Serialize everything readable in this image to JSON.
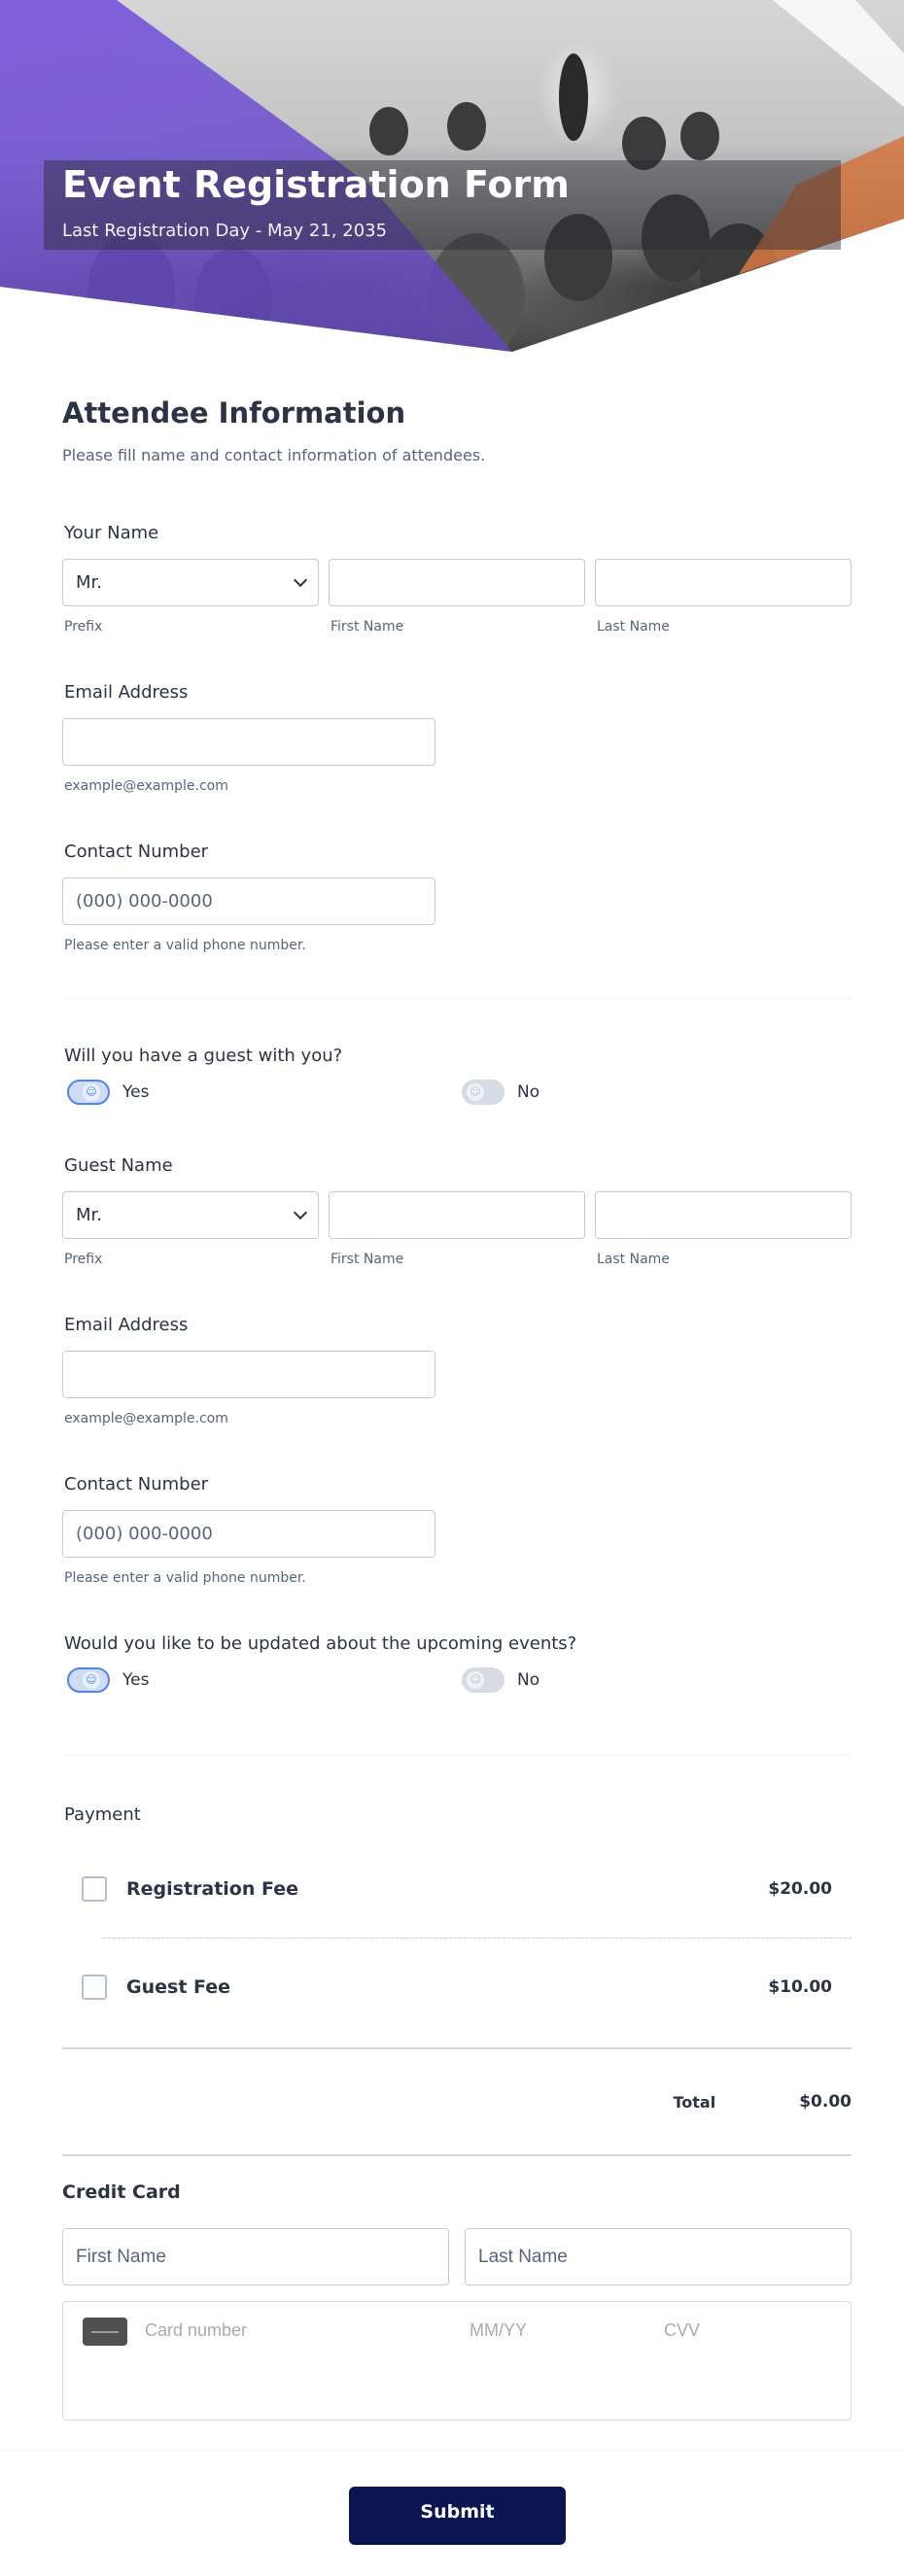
{
  "header": {
    "title": "Event Registration Form",
    "subtitle": "Last Registration Day - May 21, 2035"
  },
  "attendee": {
    "heading": "Attendee Information",
    "description": "Please fill name and contact information of attendees.",
    "name_label": "Your Name",
    "prefix_value": "Mr.",
    "prefix_sublabel": "Prefix",
    "first_sublabel": "First Name",
    "last_sublabel": "Last Name",
    "email_label": "Email Address",
    "email_sublabel": "example@example.com",
    "phone_label": "Contact Number",
    "phone_placeholder": "(000) 000-0000",
    "phone_sublabel": "Please enter a valid phone number."
  },
  "guest_question": {
    "label": "Will you have a guest with you?",
    "yes": "Yes",
    "no": "No",
    "selected": "Yes"
  },
  "guest": {
    "name_label": "Guest Name",
    "prefix_value": "Mr.",
    "prefix_sublabel": "Prefix",
    "first_sublabel": "First Name",
    "last_sublabel": "Last Name",
    "email_label": "Email Address",
    "email_sublabel": "example@example.com",
    "phone_label": "Contact Number",
    "phone_placeholder": "(000) 000-0000",
    "phone_sublabel": "Please enter a valid phone number."
  },
  "updates_question": {
    "label": "Would you like to be updated about the upcoming events?",
    "yes": "Yes",
    "no": "No",
    "selected": "Yes"
  },
  "payment": {
    "label": "Payment",
    "items": [
      {
        "name": "Registration Fee",
        "price": "$20.00",
        "checked": false
      },
      {
        "name": "Guest Fee",
        "price": "$10.00",
        "checked": false
      }
    ],
    "total_label": "Total",
    "total_value": "$0.00"
  },
  "credit_card": {
    "title": "Credit Card",
    "first_placeholder": "First Name",
    "last_placeholder": "Last Name",
    "card_number_placeholder": "Card number",
    "expiry_placeholder": "MM/YY",
    "cvv_placeholder": "CVV"
  },
  "submit_label": "Submit",
  "colors": {
    "accent": "#4d86e3",
    "submit_bg": "#0a1551",
    "header_purple": "#7a5ade",
    "header_orange": "#e88c50"
  }
}
